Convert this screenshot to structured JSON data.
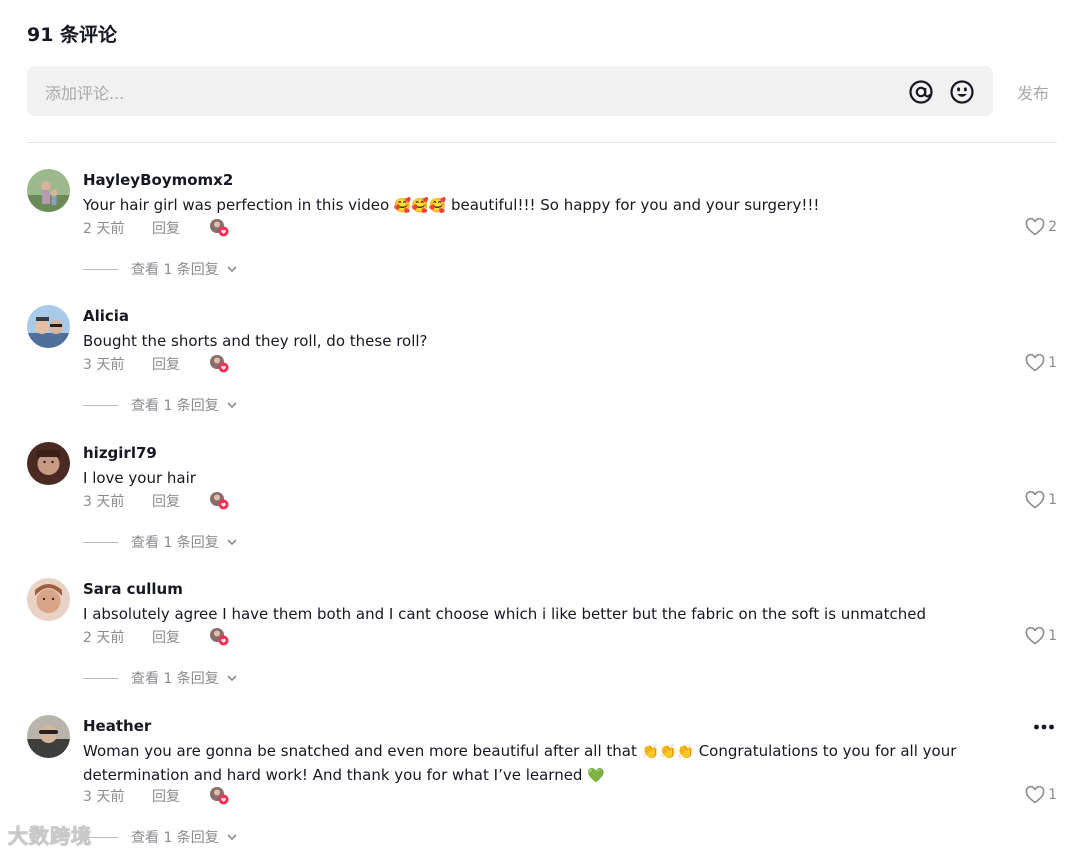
{
  "header": {
    "title": "91 条评论"
  },
  "composer": {
    "placeholder": "添加评论...",
    "at_icon": "at-icon",
    "emoji_icon": "emoji-icon",
    "post_label": "发布"
  },
  "comments": [
    {
      "username": "HayleyBoymomx2",
      "text_before": "Your hair girl was perfection in this video ",
      "emojis": "🥰🥰🥰",
      "text_after": " beautiful!!! So happy for you and your surgery!!!",
      "time": "2 天前",
      "reply_label": "回复",
      "likes": "2",
      "view_replies": "查看 1 条回复",
      "avatar_color": "#6a8a58"
    },
    {
      "username": "Alicia",
      "text": "Bought the shorts and they roll, do these roll?",
      "time": "3 天前",
      "reply_label": "回复",
      "likes": "1",
      "view_replies": "查看 1 条回复",
      "avatar_color": "#7aa0c8"
    },
    {
      "username": "hizgirl79",
      "text": "I love your hair",
      "time": "3 天前",
      "reply_label": "回复",
      "likes": "1",
      "view_replies": "查看 1 条回复",
      "avatar_color": "#5a3a2e"
    },
    {
      "username": "Sara cullum",
      "text": "I absolutely agree I have them both and I cant choose which i like better but the fabric on the soft is unmatched",
      "time": "2 天前",
      "reply_label": "回复",
      "likes": "1",
      "view_replies": "查看 1 条回复",
      "avatar_color": "#c98f78"
    },
    {
      "username": "Heather",
      "text_before": "Woman you are gonna be snatched and even more beautiful after all that ",
      "emojis": "👏👏👏",
      "text_after": " Congratulations to you for all your determination and hard work! And thank you for what I’ve learned ",
      "emoji_end": "💚",
      "time": "3 天前",
      "reply_label": "回复",
      "likes": "1",
      "view_replies": "查看 1 条回复",
      "avatar_color": "#8d8c86"
    }
  ],
  "watermark": "大数跨境",
  "colors": {
    "accent_like": "#fe2c55",
    "text_secondary": "#8a8b91",
    "input_bg": "#f1f1f2"
  }
}
